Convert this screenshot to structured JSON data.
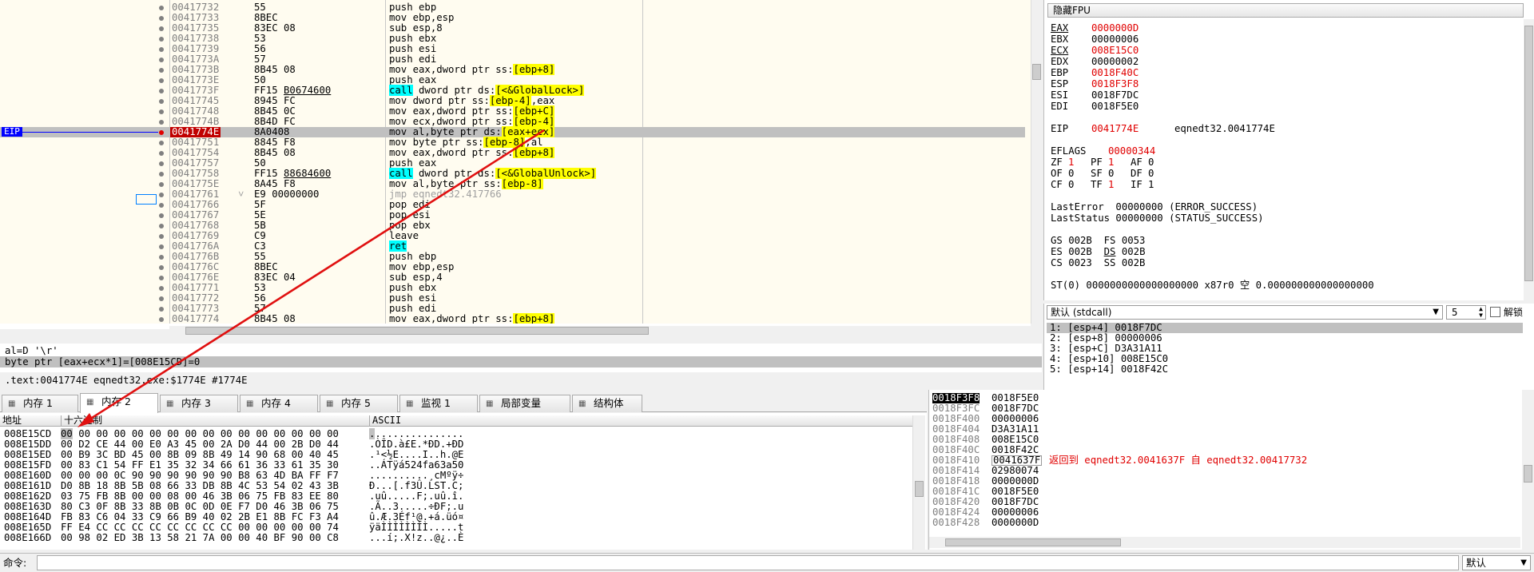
{
  "disasm": {
    "rows": [
      {
        "addr": "00417732",
        "bytes": "55",
        "instr": [
          {
            "t": "push ebp"
          }
        ]
      },
      {
        "addr": "00417733",
        "bytes": "8BEC",
        "instr": [
          {
            "t": "mov ebp,esp"
          }
        ]
      },
      {
        "addr": "00417735",
        "bytes": "83EC 08",
        "instr": [
          {
            "t": "sub esp,8"
          }
        ]
      },
      {
        "addr": "00417738",
        "bytes": "53",
        "instr": [
          {
            "t": "push ebx"
          }
        ]
      },
      {
        "addr": "00417739",
        "bytes": "56",
        "instr": [
          {
            "t": "push esi"
          }
        ]
      },
      {
        "addr": "0041773A",
        "bytes": "57",
        "instr": [
          {
            "t": "push edi"
          }
        ]
      },
      {
        "addr": "0041773B",
        "bytes": "8B45 08",
        "instr": [
          {
            "t": "mov eax,dword ptr ss:"
          },
          {
            "t": "[ebp+8]",
            "c": "mem"
          }
        ]
      },
      {
        "addr": "0041773E",
        "bytes": "50",
        "instr": [
          {
            "t": "push eax"
          }
        ]
      },
      {
        "addr": "0041773F",
        "bytes": "FF15 B0674600",
        "ul": true,
        "instr": [
          {
            "t": "call",
            "c": "call"
          },
          {
            "t": " dword ptr ds:"
          },
          {
            "t": "[<&GlobalLock>]",
            "c": "mem"
          }
        ]
      },
      {
        "addr": "00417745",
        "bytes": "8945 FC",
        "instr": [
          {
            "t": "mov dword ptr ss:"
          },
          {
            "t": "[ebp-4]",
            "c": "mem"
          },
          {
            "t": ",eax"
          }
        ]
      },
      {
        "addr": "00417748",
        "bytes": "8B45 0C",
        "instr": [
          {
            "t": "mov eax,dword ptr ss:"
          },
          {
            "t": "[ebp+C]",
            "c": "mem"
          }
        ]
      },
      {
        "addr": "0041774B",
        "bytes": "8B4D FC",
        "instr": [
          {
            "t": "mov ecx,dword ptr ss:"
          },
          {
            "t": "[ebp-4]",
            "c": "mem"
          }
        ]
      },
      {
        "addr": "0041774E",
        "bytes": "8A0408",
        "sel": true,
        "instr": [
          {
            "t": "mov al,byte ptr ds:"
          },
          {
            "t": "[eax+ecx]",
            "c": "mem"
          }
        ]
      },
      {
        "addr": "00417751",
        "bytes": "8845 F8",
        "instr": [
          {
            "t": "mov byte ptr ss:"
          },
          {
            "t": "[ebp-8]",
            "c": "mem"
          },
          {
            "t": ",al"
          }
        ]
      },
      {
        "addr": "00417754",
        "bytes": "8B45 08",
        "instr": [
          {
            "t": "mov eax,dword ptr ss:"
          },
          {
            "t": "[ebp+8]",
            "c": "mem"
          }
        ]
      },
      {
        "addr": "00417757",
        "bytes": "50",
        "instr": [
          {
            "t": "push eax"
          }
        ]
      },
      {
        "addr": "00417758",
        "bytes": "FF15 88684600",
        "ul": true,
        "instr": [
          {
            "t": "call",
            "c": "call"
          },
          {
            "t": " dword ptr ds:"
          },
          {
            "t": "[<&GlobalUnlock>]",
            "c": "mem"
          }
        ]
      },
      {
        "addr": "0041775E",
        "bytes": "8A45 F8",
        "instr": [
          {
            "t": "mov al,byte ptr ss:"
          },
          {
            "t": "[ebp-8]",
            "c": "mem"
          }
        ]
      },
      {
        "addr": "00417761",
        "bytes": "E9 00000000",
        "jmp": true,
        "instr": [
          {
            "t": "jmp eqnedt32.417766",
            "c": "grey"
          }
        ]
      },
      {
        "addr": "00417766",
        "bytes": "5F",
        "instr": [
          {
            "t": "pop edi"
          }
        ]
      },
      {
        "addr": "00417767",
        "bytes": "5E",
        "instr": [
          {
            "t": "pop esi"
          }
        ]
      },
      {
        "addr": "00417768",
        "bytes": "5B",
        "instr": [
          {
            "t": "pop ebx"
          }
        ]
      },
      {
        "addr": "00417769",
        "bytes": "C9",
        "instr": [
          {
            "t": "leave"
          }
        ]
      },
      {
        "addr": "0041776A",
        "bytes": "C3",
        "instr": [
          {
            "t": "ret",
            "c": "call"
          }
        ]
      },
      {
        "addr": "0041776B",
        "bytes": "55",
        "instr": [
          {
            "t": "push ebp"
          }
        ]
      },
      {
        "addr": "0041776C",
        "bytes": "8BEC",
        "instr": [
          {
            "t": "mov ebp,esp"
          }
        ]
      },
      {
        "addr": "0041776E",
        "bytes": "83EC 04",
        "instr": [
          {
            "t": "sub esp,4"
          }
        ]
      },
      {
        "addr": "00417771",
        "bytes": "53",
        "instr": [
          {
            "t": "push ebx"
          }
        ]
      },
      {
        "addr": "00417772",
        "bytes": "56",
        "instr": [
          {
            "t": "push esi"
          }
        ]
      },
      {
        "addr": "00417773",
        "bytes": "57",
        "instr": [
          {
            "t": "push edi"
          }
        ]
      },
      {
        "addr": "00417774",
        "bytes": "8B45 08",
        "instr": [
          {
            "t": "mov eax,dword ptr ss:"
          },
          {
            "t": "[ebp+8]",
            "c": "mem"
          }
        ]
      }
    ],
    "eip_label": "EIP"
  },
  "info": {
    "line1": "al=D '\\r'",
    "line2": "byte ptr [eax+ecx*1]=[008E15CD]=0",
    "line3": ".text:0041774E eqnedt32.exe:$1774E #1774E"
  },
  "registers": {
    "title": "隐藏FPU",
    "gpr": [
      {
        "k": "EAX",
        "v": "0000000D",
        "red": true,
        "ul": true
      },
      {
        "k": "EBX",
        "v": "00000006"
      },
      {
        "k": "ECX",
        "v": "008E15C0",
        "red": true,
        "ul": true
      },
      {
        "k": "EDX",
        "v": "00000002"
      },
      {
        "k": "EBP",
        "v": "0018F40C",
        "red": true
      },
      {
        "k": "ESP",
        "v": "0018F3F8",
        "red": true
      },
      {
        "k": "ESI",
        "v": "0018F7DC"
      },
      {
        "k": "EDI",
        "v": "0018F5E0"
      }
    ],
    "eip": {
      "k": "EIP",
      "v": "0041774E",
      "c": "eqnedt32.0041774E"
    },
    "eflags": {
      "k": "EFLAGS",
      "v": "00000344"
    },
    "flags": [
      [
        {
          "k": "ZF",
          "v": "1",
          "red": true
        },
        {
          "k": "PF",
          "v": "1",
          "red": true
        },
        {
          "k": "AF",
          "v": "0"
        }
      ],
      [
        {
          "k": "OF",
          "v": "0"
        },
        {
          "k": "SF",
          "v": "0"
        },
        {
          "k": "DF",
          "v": "0"
        }
      ],
      [
        {
          "k": "CF",
          "v": "0"
        },
        {
          "k": "TF",
          "v": "1",
          "red": true
        },
        {
          "k": "IF",
          "v": "1"
        }
      ]
    ],
    "lasterror": "LastError  00000000 (ERROR_SUCCESS)",
    "laststatus": "LastStatus 00000000 (STATUS_SUCCESS)",
    "seg1": "GS 002B  FS 0053",
    "seg2a": "ES 002B  ",
    "seg2b": "DS",
    "seg2c": " 002B",
    "seg3": "CS 0023  SS 002B",
    "st0": "ST(0) 0000000000000000000 x87r0 空 0.000000000000000000"
  },
  "callconv": {
    "select": "默认 (stdcall)",
    "count": "5",
    "unlock": "解锁",
    "rows": [
      "1: [esp+4] 0018F7DC",
      "2: [esp+8] 00000006",
      "3: [esp+C] D3A31A11",
      "4: [esp+10] 008E15C0",
      "5: [esp+14] 0018F42C"
    ]
  },
  "tabs": [
    {
      "label": "内存 1",
      "icon": "memory-icon"
    },
    {
      "label": "内存 2",
      "icon": "memory-icon",
      "active": true
    },
    {
      "label": "内存 3",
      "icon": "memory-icon"
    },
    {
      "label": "内存 4",
      "icon": "memory-icon"
    },
    {
      "label": "内存 5",
      "icon": "memory-icon"
    },
    {
      "label": "监视 1",
      "icon": "watch-icon"
    },
    {
      "label": "局部变量",
      "icon": "locals-icon"
    },
    {
      "label": "结构体",
      "icon": "struct-icon"
    }
  ],
  "dump": {
    "headers": {
      "addr": "地址",
      "hex": "十六进制",
      "ascii": "ASCII"
    },
    "rows": [
      {
        "a": "008E15CD",
        "h": "00 00 00 00 00 00 00 00 00 00 00 00 00 00 00 00",
        "x": "................"
      },
      {
        "a": "008E15DD",
        "h": "00 D2 CE 44 00 E0 A3 45 00 2A D0 44 00 2B D0 44",
        "x": ".ÒÎD.à£E.*ÐD.+ÐD"
      },
      {
        "a": "008E15ED",
        "h": "00 B9 3C BD 45 00 8B 09 8B 49 14 90 68 00 40 45",
        "x": ".¹<½E....I..h.@E"
      },
      {
        "a": "008E15FD",
        "h": "00 83 C1 54 FF E1 35 32 34 66 61 36 33 61 35 30",
        "x": "..ÁTÿá524fa63a50"
      },
      {
        "a": "008E160D",
        "h": "00 00 00 0C 90 90 90 90 90 90 B8 63 4D BA FF F7",
        "x": "..........¸cMºÿ÷"
      },
      {
        "a": "008E161D",
        "h": "D0 8B 18 8B 5B 08 66 33 DB 8B 4C 53 54 02 43 3B",
        "x": "Ð...[.f3Û.LST.C;"
      },
      {
        "a": "008E162D",
        "h": "03 75 FB 8B 00 00 08 00 46 3B 06 75 FB 83 EE 80",
        "x": ".uû.....F;.uû.î."
      },
      {
        "a": "008E163D",
        "h": "80 C3 0F 8B 33 8B 0B 0C 0D 0E F7 D0 46 3B 06 75",
        "x": ".Ã..3.....÷ÐF;.u"
      },
      {
        "a": "008E164D",
        "h": "FB 83 C6 04 33 C9 66 B9 40 02 2B E1 8B FC F3 A4",
        "x": "û.Æ.3Éf¹@.+á.üó¤"
      },
      {
        "a": "008E165D",
        "h": "FF E4 CC CC CC CC CC CC CC CC 00 00 00 00 00 74",
        "x": "ÿäÌÌÌÌÌÌÌÌ.....t"
      },
      {
        "a": "008E166D",
        "h": "00 98 02 ED 3B 13 58 21 7A 00 00 40 BF 90 00 C8",
        "x": "...í;.X!z..@¿..È"
      }
    ]
  },
  "stack": {
    "rows": [
      {
        "a": "0018F3F8",
        "v": "0018F5E0",
        "top": true
      },
      {
        "a": "0018F3FC",
        "v": "0018F7DC"
      },
      {
        "a": "0018F400",
        "v": "00000006"
      },
      {
        "a": "0018F404",
        "v": "D3A31A11"
      },
      {
        "a": "0018F408",
        "v": "008E15C0"
      },
      {
        "a": "0018F40C",
        "v": "0018F42C"
      },
      {
        "a": "0018F410",
        "v": "0041637F",
        "c": "返回到 eqnedt32.0041637F 自 eqnedt32.00417732"
      },
      {
        "a": "0018F414",
        "v": "02980074"
      },
      {
        "a": "0018F418",
        "v": "0000000D"
      },
      {
        "a": "0018F41C",
        "v": "0018F5E0"
      },
      {
        "a": "0018F420",
        "v": "0018F7DC"
      },
      {
        "a": "0018F424",
        "v": "00000006"
      },
      {
        "a": "0018F428",
        "v": "0000000D"
      }
    ]
  },
  "cmdbar": {
    "label": "命令:",
    "default": "默认"
  }
}
